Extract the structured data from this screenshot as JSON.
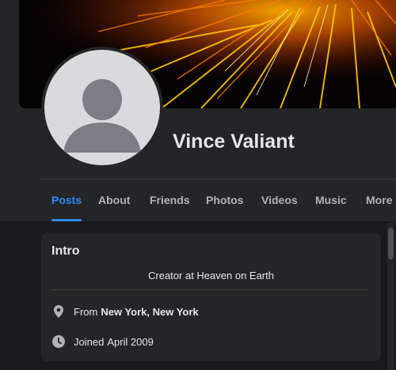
{
  "profile": {
    "name": "Vince Valiant"
  },
  "tabs": [
    {
      "label": "Posts",
      "active": true
    },
    {
      "label": "About",
      "active": false
    },
    {
      "label": "Friends",
      "active": false
    },
    {
      "label": "Photos",
      "active": false
    },
    {
      "label": "Videos",
      "active": false
    },
    {
      "label": "Music",
      "active": false
    },
    {
      "label": "More",
      "active": false
    }
  ],
  "intro": {
    "title": "Intro",
    "bio": "Creator at Heaven on Earth",
    "location_prefix": "From",
    "location": "New York, New York",
    "joined_prefix": "Joined",
    "joined": "April 2009"
  },
  "icons": {
    "location": "map-pin-icon",
    "joined": "clock-icon"
  },
  "colors": {
    "accent": "#2d88ff",
    "background": "#18191a",
    "surface": "#242526",
    "text_primary": "#e4e6eb",
    "text_secondary": "#b0b3b8"
  }
}
